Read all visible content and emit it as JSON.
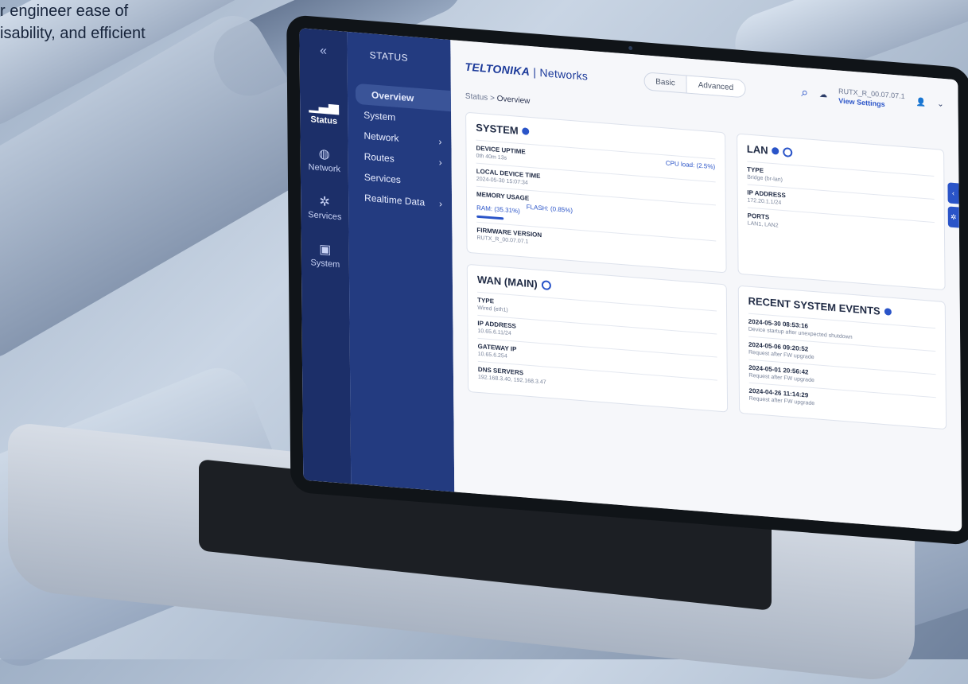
{
  "hero": {
    "line1": "r engineer ease of",
    "line2": "isability, and efficient"
  },
  "rail": {
    "collapse_icon": "«",
    "items": [
      {
        "label": "Status",
        "icon": "signal-icon"
      },
      {
        "label": "Network",
        "icon": "globe-icon"
      },
      {
        "label": "Services",
        "icon": "gear-icon"
      },
      {
        "label": "System",
        "icon": "file-icon"
      }
    ]
  },
  "side": {
    "header": "STATUS",
    "items": [
      {
        "label": "Overview",
        "chevron": ""
      },
      {
        "label": "System",
        "chevron": ""
      },
      {
        "label": "Network",
        "chevron": "›"
      },
      {
        "label": "Routes",
        "chevron": "›"
      },
      {
        "label": "Services",
        "chevron": ""
      },
      {
        "label": "Realtime Data",
        "chevron": "›"
      }
    ]
  },
  "topbar": {
    "logo_brand": "TELTONIKA",
    "logo_divider": " | ",
    "logo_suffix": "Networks",
    "mode_basic": "Basic",
    "mode_advanced": "Advanced",
    "device_id": "RUTX_R_00.07.07.1",
    "view_settings": "View Settings"
  },
  "breadcrumb": {
    "root": "Status",
    "sep": " > ",
    "current": "Overview"
  },
  "system": {
    "title": "SYSTEM",
    "uptime_label": "DEVICE UPTIME",
    "uptime_value": "0th 40m 13s",
    "cpu_link": "CPU load: (2.5%)",
    "time_label": "LOCAL DEVICE TIME",
    "time_value": "2024-05-30 15:07:34",
    "memory_label": "MEMORY USAGE",
    "ram_link": "RAM: (35.31%)",
    "flash_link": "FLASH: (0.85%)",
    "firmware_label": "FIRMWARE VERSION",
    "firmware_value": "RUTX_R_00.07.07.1"
  },
  "lan": {
    "title": "LAN",
    "type_label": "TYPE",
    "type_value": "Bridge (br-lan)",
    "ip_label": "IP ADDRESS",
    "ip_value": "172.20.1.1/24",
    "ports_label": "PORTS",
    "ports_value": "LAN1, LAN2"
  },
  "wan": {
    "title": "WAN (MAIN)",
    "type_label": "TYPE",
    "type_value": "Wired (eth1)",
    "ip_label": "IP ADDRESS",
    "ip_value": "10.65.6.11/24",
    "gw_label": "GATEWAY IP",
    "gw_value": "10.65.6.254",
    "dns_label": "DNS SERVERS",
    "dns_value": "192.168.3.40, 192.168.3.47"
  },
  "events": {
    "title": "RECENT SYSTEM EVENTS",
    "items": [
      {
        "when": "2024-05-30 08:53:16",
        "what": "Device startup after unexpected shutdown"
      },
      {
        "when": "2024-05-06 09:20:52",
        "what": "Request after FW upgrade"
      },
      {
        "when": "2024-05-01 20:56:42",
        "what": "Request after FW upgrade"
      },
      {
        "when": "2024-04-26 11:14:29",
        "what": "Request after FW upgrade"
      }
    ]
  },
  "colors": {
    "rail": "#1c2f69",
    "sidebar": "#233b80",
    "accent": "#2a54c8"
  }
}
